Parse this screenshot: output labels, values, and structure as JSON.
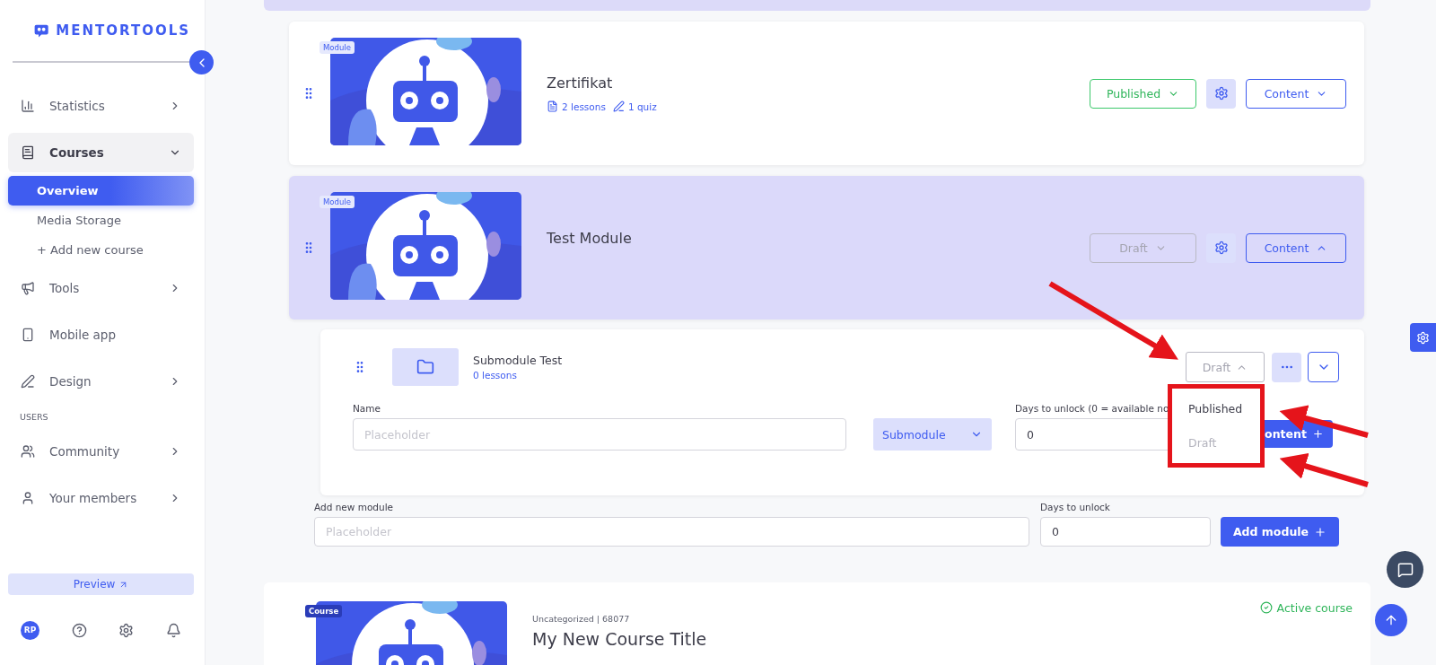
{
  "sidebar": {
    "logo": "MENTORTOOLS",
    "items": [
      {
        "kind": "group",
        "label": "Statistics",
        "expanded": false
      },
      {
        "kind": "group",
        "label": "Courses",
        "expanded": true,
        "children": [
          {
            "label": "Overview",
            "selected": true
          },
          {
            "label": "Media Storage",
            "selected": false
          },
          {
            "label": "+ Add new course",
            "selected": false
          }
        ]
      },
      {
        "kind": "group",
        "label": "Tools",
        "expanded": false
      },
      {
        "kind": "link",
        "label": "Mobile app"
      },
      {
        "kind": "group",
        "label": "Design",
        "expanded": false
      },
      {
        "kind": "section",
        "label": "USERS"
      },
      {
        "kind": "group",
        "label": "Community",
        "expanded": false
      },
      {
        "kind": "group",
        "label": "Your members",
        "expanded": false
      }
    ],
    "preview": "Preview",
    "avatar": "RP"
  },
  "modules": [
    {
      "badge": "Module",
      "title": "Zertifikat",
      "meta": [
        {
          "kind": "lessons",
          "text": "2 lessons"
        },
        {
          "kind": "quiz",
          "text": "1 quiz"
        }
      ],
      "status": "Published",
      "published": true,
      "content": "Content",
      "expanded": false
    },
    {
      "badge": "Module",
      "title": "Test Module",
      "status": "Draft",
      "published": false,
      "content": "Content",
      "expanded": true
    }
  ],
  "submodule": {
    "title": "Submodule Test",
    "lessons": "0 lessons",
    "status": "Draft",
    "dropdown_open": true,
    "options": [
      {
        "label": "Published",
        "disabled": false
      },
      {
        "label": "Draft",
        "disabled": true
      }
    ],
    "name_label": "Name",
    "name_placeholder": "Placeholder",
    "type": "Submodule",
    "days_label": "Days to unlock (0 = available no",
    "days_value": "0",
    "content_button": "ontent"
  },
  "add_module": {
    "label": "Add new module",
    "placeholder": "Placeholder",
    "days_label": "Days to unlock",
    "days_value": "0",
    "button": "Add module"
  },
  "course": {
    "badge": "Course",
    "category": "Uncategorized | 68077",
    "title": "My New Course Title",
    "status": "Active course"
  }
}
